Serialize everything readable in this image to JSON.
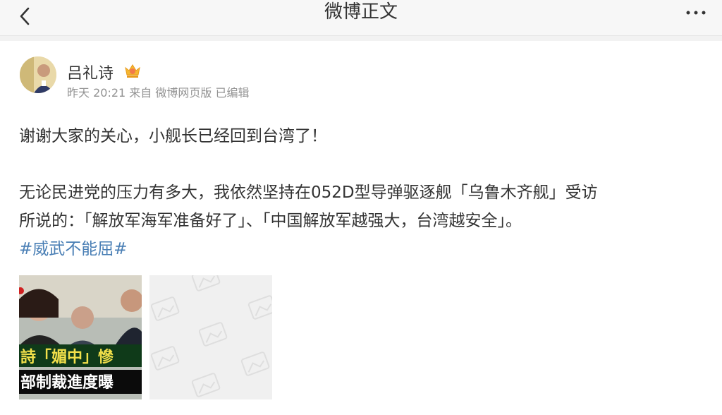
{
  "nav": {
    "title": "微博正文",
    "back_icon": "chevron-left-icon",
    "more_icon": "more-dots-icon"
  },
  "post": {
    "author": "吕礼诗",
    "badge_icon": "crown-badge-icon",
    "meta": "昨天 20:21 来自 微博网页版 已编辑",
    "line1": "谢谢大家的关心，小舰长已经回到台湾了！",
    "line2": "无论民进党的压力有多大，我依然坚持在052D型导弹驱逐舰「乌鲁木齐舰」受访",
    "line3": "所说的：「解放军海军准备好了」、「中国解放军越强大，台湾越安全」。",
    "hashtag": "#威武不能屈#",
    "images": [
      {
        "caption1": "詩「媚中」慘",
        "caption2": "部制裁進度曝"
      },
      {
        "placeholder_icon": "image-placeholder-icon"
      }
    ]
  },
  "colors": {
    "link": "#4a7fb5",
    "meta": "#939393",
    "text": "#333333"
  }
}
